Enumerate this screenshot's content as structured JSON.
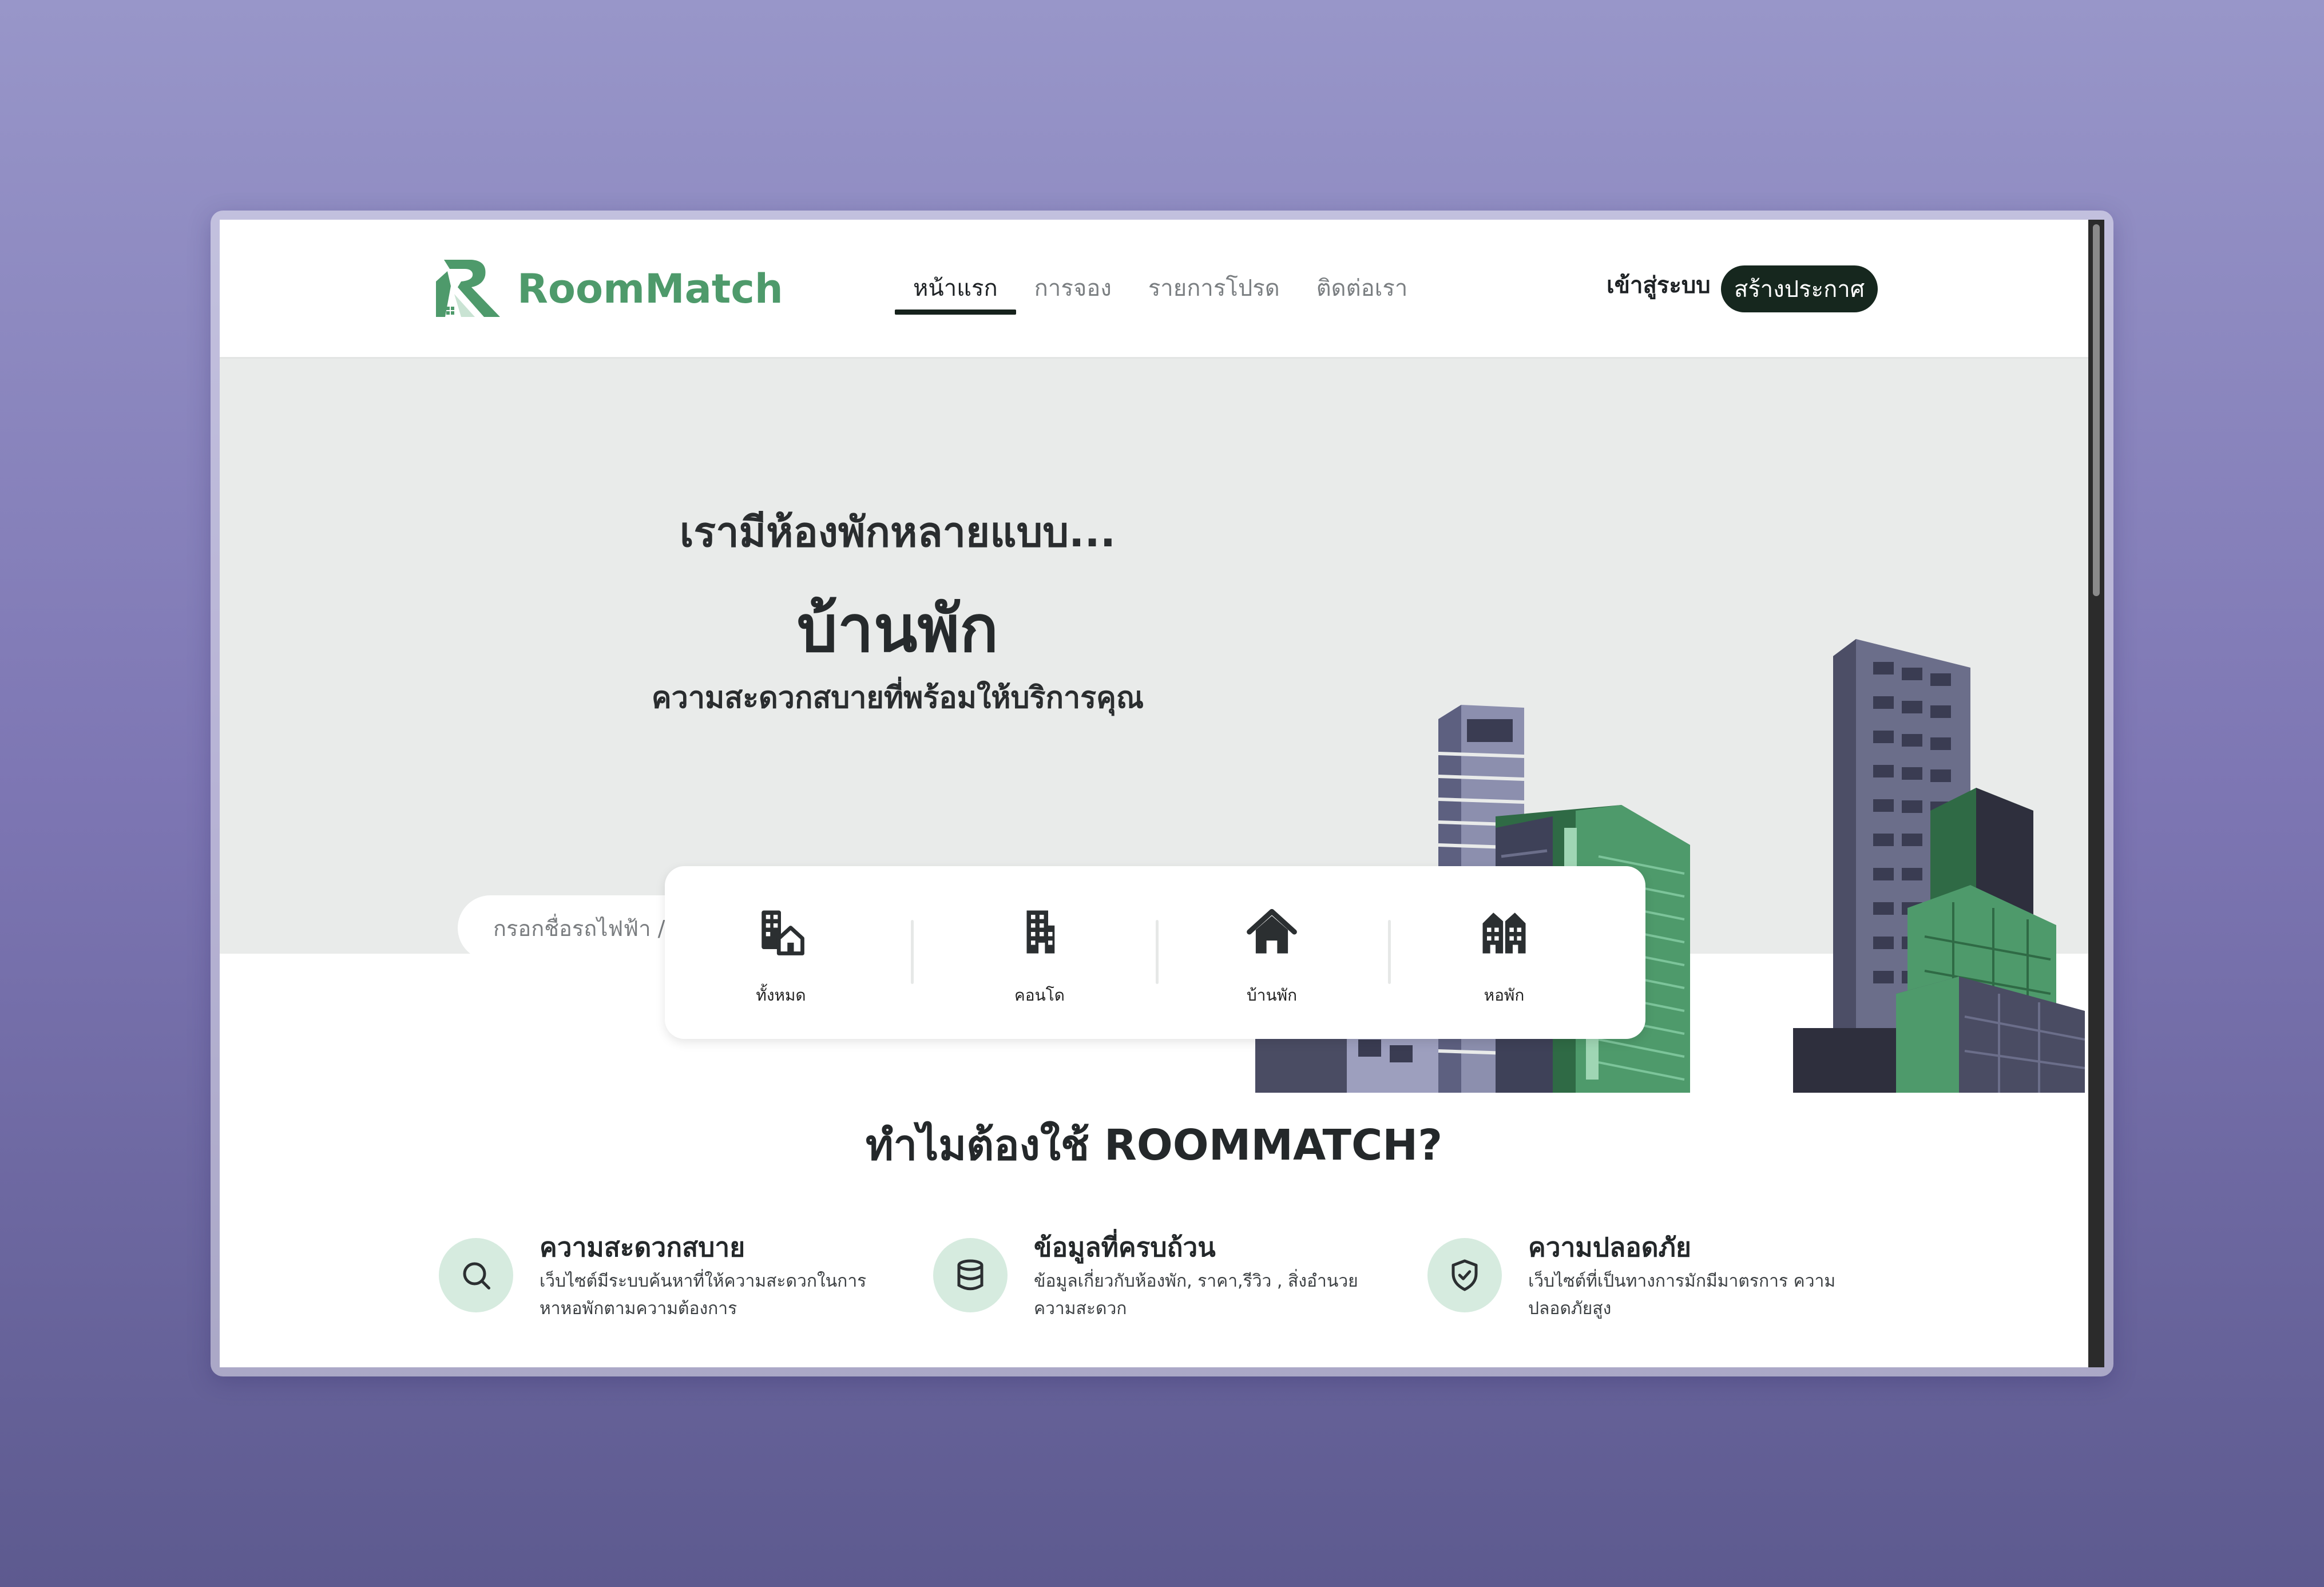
{
  "brand": {
    "name": "RoomMatch"
  },
  "nav": {
    "items": [
      {
        "label": "หน้าแรก",
        "active": true
      },
      {
        "label": "การจอง",
        "active": false
      },
      {
        "label": "รายการโปรด",
        "active": false
      },
      {
        "label": "ติดต่อเรา",
        "active": false
      }
    ],
    "login_label": "เข้าสู่ระบบ",
    "create_label": "สร้างประกาศ"
  },
  "hero": {
    "line1": "เรามีห้องพักหลายแบบ...",
    "line2": "บ้านพัก",
    "line3": "ความสะดวกสบายที่พร้อมให้บริการคุณ",
    "search_placeholder": "กรอกชื่อรถไฟฟ้า / ชื่อโครงการ",
    "map_icon": "map-icon",
    "search_icon": "search-icon"
  },
  "categories": [
    {
      "label": "ทั้งหมด",
      "icon": "buildings-home-icon"
    },
    {
      "label": "คอนโด",
      "icon": "building-icon"
    },
    {
      "label": "บ้านพัก",
      "icon": "house-icon"
    },
    {
      "label": "หอพัก",
      "icon": "dormitory-icon"
    }
  ],
  "why": {
    "title": "ทำไมต้องใช้ ROOMMATCH?",
    "features": [
      {
        "title": "ความสะดวกสบาย",
        "desc": "เว็บไซต์มีระบบค้นหาที่ให้ความสะดวกในการหาหอพักตามความต้องการ",
        "icon": "search-icon"
      },
      {
        "title": "ข้อมูลที่ครบถ้วน",
        "desc": "ข้อมูลเกี่ยวกับห้องพัก, ราคา,รีวิว , สิ่งอำนวยความสะดวก",
        "icon": "database-icon"
      },
      {
        "title": "ความปลอดภัย",
        "desc": "เว็บไซต์ที่เป็นทางการมักมีมาตรการ ความปลอดภัยสูง",
        "icon": "shield-check-icon"
      }
    ]
  },
  "colors": {
    "accent": "#4e9a6b",
    "dark_button": "#16271e",
    "hero_bg": "#e9ebea",
    "icon_circle": "#d6ebdf"
  }
}
